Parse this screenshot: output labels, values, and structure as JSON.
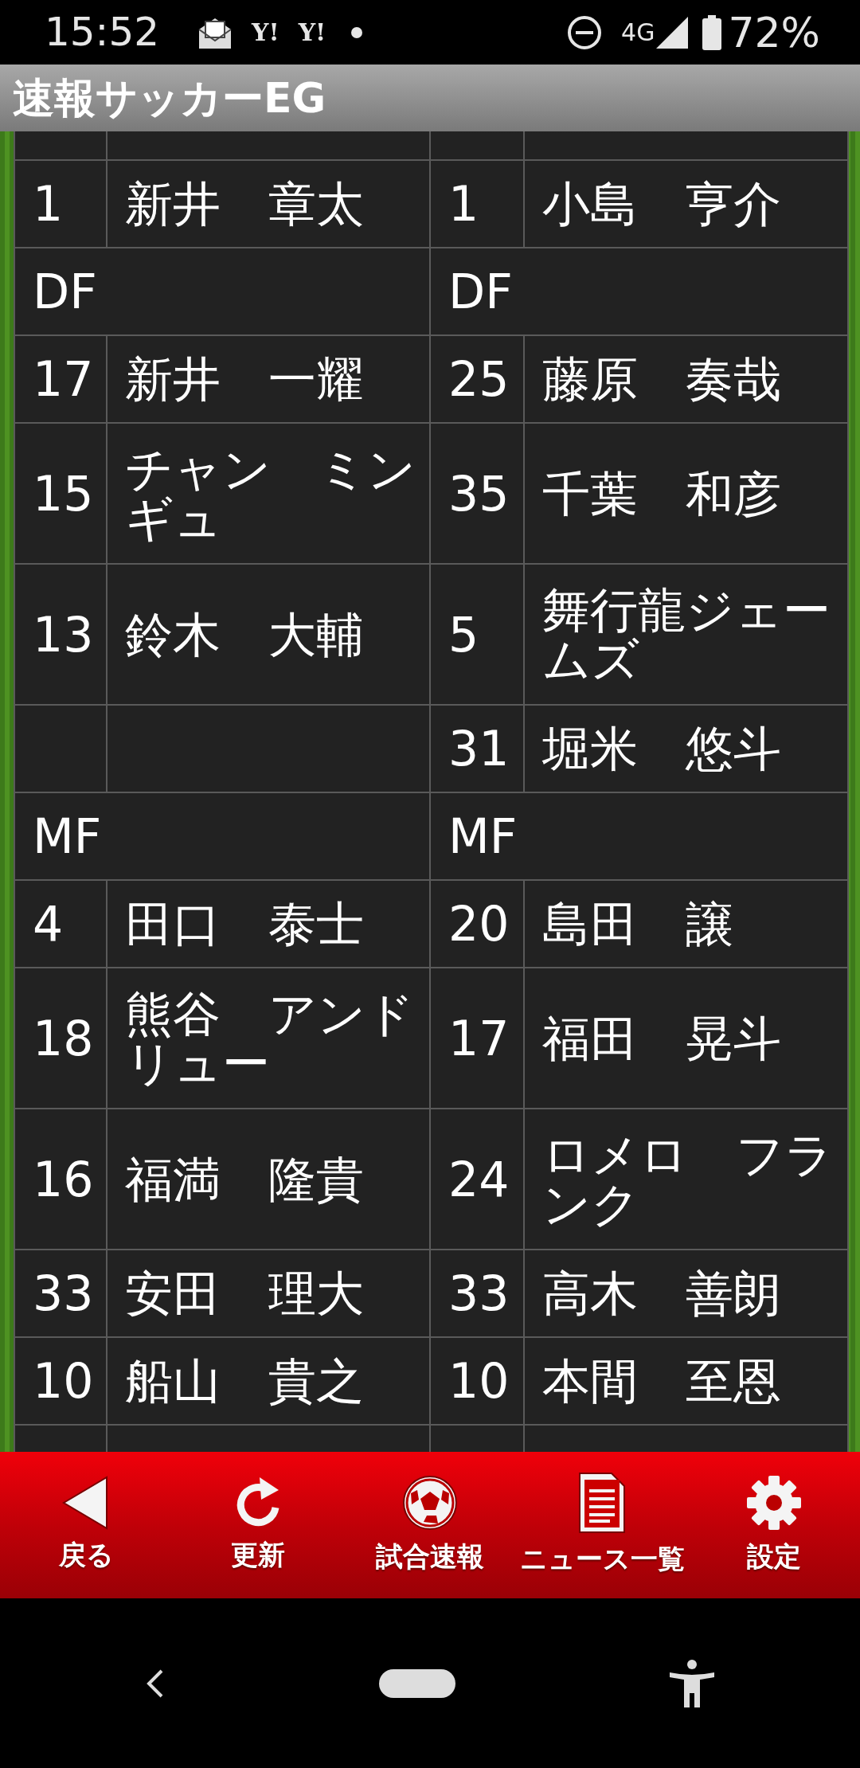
{
  "status_bar": {
    "time": "15:52",
    "notifications": [
      "Y!",
      "Y!"
    ],
    "network": "4G",
    "battery": "72%"
  },
  "app_bar": {
    "title": "速報サッカーEG"
  },
  "lineup": [
    {
      "kind": "player",
      "left": {
        "number": "1",
        "name": "新井　章太"
      },
      "right": {
        "number": "1",
        "name": "小島　亨介"
      }
    },
    {
      "kind": "position",
      "left": "DF",
      "right": "DF"
    },
    {
      "kind": "player",
      "left": {
        "number": "17",
        "name": "新井　一耀"
      },
      "right": {
        "number": "25",
        "name": "藤原　奏哉"
      }
    },
    {
      "kind": "player",
      "left": {
        "number": "15",
        "name": "チャン　ミンギュ"
      },
      "right": {
        "number": "35",
        "name": "千葉　和彦"
      }
    },
    {
      "kind": "player",
      "left": {
        "number": "13",
        "name": "鈴木　大輔"
      },
      "right": {
        "number": "5",
        "name": "舞行龍ジェームズ"
      }
    },
    {
      "kind": "player",
      "right": {
        "number": "31",
        "name": "堀米　悠斗"
      }
    },
    {
      "kind": "position",
      "left": "MF",
      "right": "MF"
    },
    {
      "kind": "player",
      "left": {
        "number": "4",
        "name": "田口　泰士"
      },
      "right": {
        "number": "20",
        "name": "島田　譲"
      }
    },
    {
      "kind": "player",
      "left": {
        "number": "18",
        "name": "熊谷　アンドリュー"
      },
      "right": {
        "number": "17",
        "name": "福田　晃斗"
      }
    },
    {
      "kind": "player",
      "left": {
        "number": "16",
        "name": "福満　隆貴"
      },
      "right": {
        "number": "24",
        "name": "ロメロ　フランク"
      }
    },
    {
      "kind": "player",
      "left": {
        "number": "33",
        "name": "安田　理大"
      },
      "right": {
        "number": "33",
        "name": "高木　善朗"
      }
    },
    {
      "kind": "player",
      "left": {
        "number": "10",
        "name": "船山　貴之"
      },
      "right": {
        "number": "10",
        "name": "本間　至恩"
      }
    }
  ],
  "bottom_nav": [
    {
      "kind": "back",
      "label": "戻る"
    },
    {
      "kind": "refresh",
      "label": "更新"
    },
    {
      "kind": "ball",
      "label": "試合速報"
    },
    {
      "kind": "news",
      "label": "ニュース一覧"
    },
    {
      "kind": "settings",
      "label": "設定"
    }
  ]
}
